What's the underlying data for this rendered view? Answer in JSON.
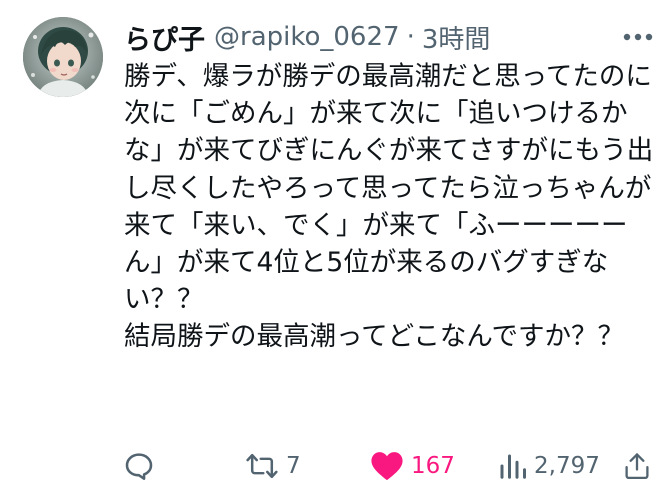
{
  "author": {
    "display_name": "らぴ子",
    "handle": "@rapiko_0627",
    "separator": "·",
    "time": "3時間"
  },
  "tweet": {
    "text": "勝デ、爆ラが勝デの最高潮だと思ってたのに次に「ごめん」が来て次に「追いつけるかな」が来てびぎにんぐが来てさすがにもう出し尽くしたやろって思ってたら泣っちゃんが来て「来い、でく」が来て「ふーーーーーん」が来て4位と5位が来るのバグすぎない？？\n結局勝デの最高潮ってどこなんですか？？"
  },
  "actions": {
    "reply": {
      "icon": "reply-icon",
      "count": ""
    },
    "retweet": {
      "icon": "retweet-icon",
      "count": "7"
    },
    "like": {
      "icon": "heart-icon",
      "count": "167",
      "liked": true
    },
    "views": {
      "icon": "views-icon",
      "count": "2,797"
    },
    "share": {
      "icon": "share-icon"
    }
  },
  "colors": {
    "text": "#0f1419",
    "secondary": "#536471",
    "like": "#f91880"
  }
}
